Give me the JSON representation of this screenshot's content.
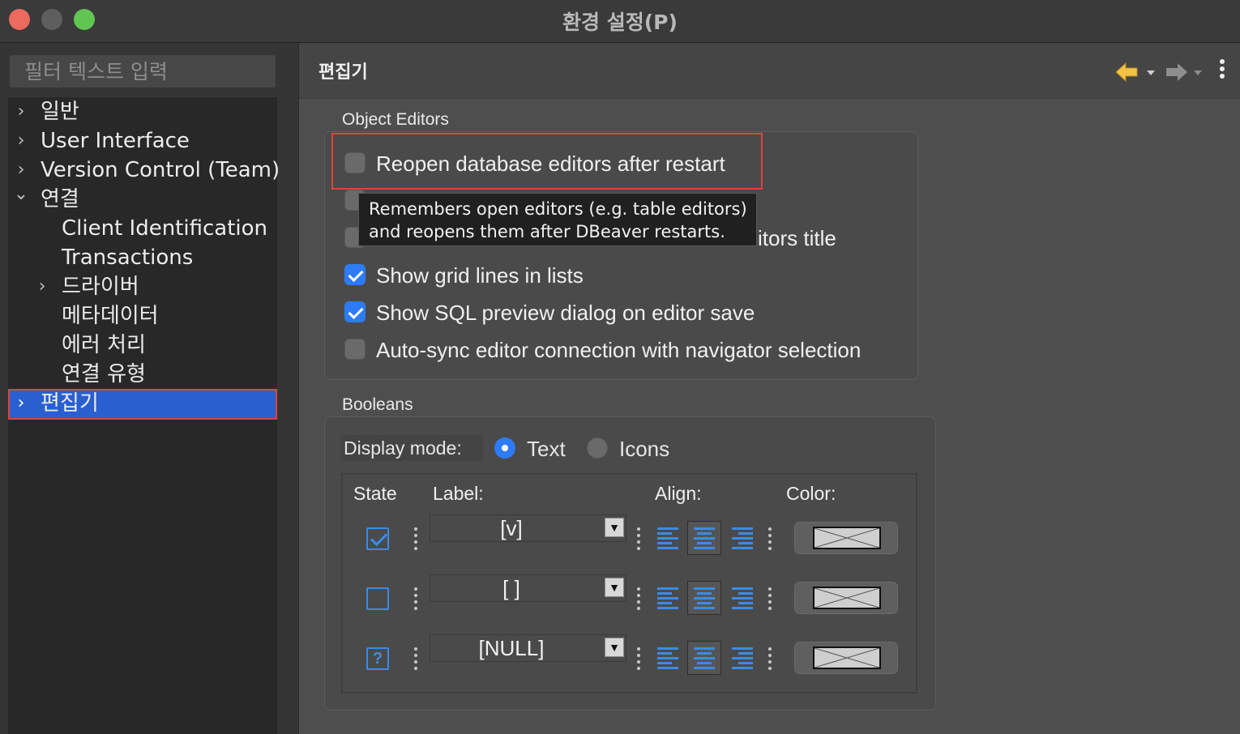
{
  "window": {
    "title": "환경 설정(P)"
  },
  "sidebar": {
    "filter_placeholder": "필터 텍스트 입력",
    "items": [
      {
        "label": "일반",
        "chevron": "›"
      },
      {
        "label": "User Interface",
        "chevron": "›"
      },
      {
        "label": "Version Control (Team)",
        "chevron": "›"
      },
      {
        "label": "연결",
        "chevron": "⌄"
      },
      {
        "label": "Client Identification"
      },
      {
        "label": "Transactions"
      },
      {
        "label": "드라이버",
        "chevron": "›"
      },
      {
        "label": "메타데이터"
      },
      {
        "label": "에러 처리"
      },
      {
        "label": "연결 유형"
      },
      {
        "label": "편집기",
        "chevron": "›",
        "selected": true
      }
    ]
  },
  "content": {
    "title": "편집기",
    "nav": {
      "back_icon": "back-arrow-icon",
      "forward_icon": "forward-arrow-icon",
      "menu_icon": "menu-icon"
    }
  },
  "object_editors": {
    "label": "Object Editors",
    "options": [
      {
        "label": "Reopen database editors after restart",
        "checked": false
      },
      {
        "label": "itors title",
        "checked": false
      },
      {
        "label": "Show grid lines in lists",
        "checked": true
      },
      {
        "label": "Show SQL preview dialog on editor save",
        "checked": true
      },
      {
        "label": "Auto-sync editor connection with navigator selection",
        "checked": false
      }
    ],
    "tooltip": {
      "line1": "Remembers open editors (e.g. table editors)",
      "line2": "and reopens them after DBeaver restarts."
    }
  },
  "booleans": {
    "label": "Booleans",
    "display_mode_label": "Display mode:",
    "modes": [
      {
        "label": "Text",
        "selected": true
      },
      {
        "label": "Icons",
        "selected": false
      }
    ],
    "columns": {
      "state": "State",
      "label": "Label:",
      "align": "Align:",
      "color": "Color:"
    },
    "rows": [
      {
        "state": "checked",
        "label": "[v]",
        "align": "center"
      },
      {
        "state": "unchecked",
        "label": "[ ]",
        "align": "center"
      },
      {
        "state": "null",
        "null_glyph": "?",
        "label": "[NULL]",
        "align": "center"
      }
    ],
    "combo_arrow": "▼"
  },
  "colors": {
    "accent": "#2d7cf5",
    "selection": "#2a5fd0",
    "highlight_border": "#e0433a",
    "icon_blue": "#3b8be8"
  }
}
